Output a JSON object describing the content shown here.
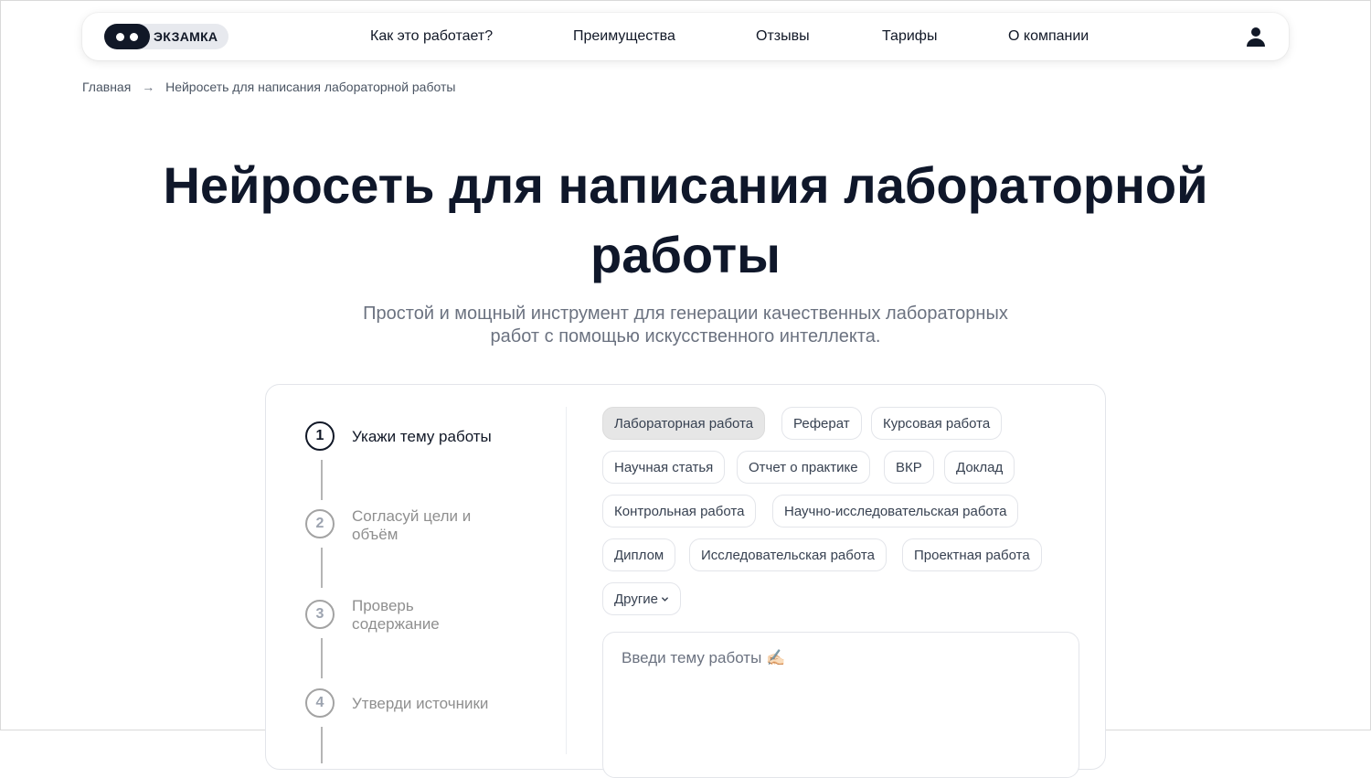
{
  "header": {
    "logo_text": "ЭКЗАМКА",
    "nav": [
      {
        "label": "Как это работает?"
      },
      {
        "label": "Преимущества"
      },
      {
        "label": "Отзывы"
      },
      {
        "label": "Тарифы"
      },
      {
        "label": "О компании"
      }
    ],
    "user_icon": "user-icon"
  },
  "breadcrumb": {
    "home": "Главная",
    "separator": "→",
    "current": "Нейросеть для написания лабораторной работы"
  },
  "hero": {
    "title_line1": "Нейросеть для написания лабораторной",
    "title_line2": "работы",
    "subtitle_line1": "Простой и мощный инструмент для генерации качественных лабораторных",
    "subtitle_line2": "работ с помощью искусственного интеллекта."
  },
  "steps": [
    {
      "number": "1",
      "label": "Укажи тему работы",
      "active": true
    },
    {
      "number": "2",
      "label": "Согласуй цели и объём",
      "active": false
    },
    {
      "number": "3",
      "label": "Проверь содержание",
      "active": false
    },
    {
      "number": "4",
      "label": "Утверди источники",
      "active": false
    }
  ],
  "work_types": {
    "selected": "Лабораторная работа",
    "items": [
      "Лабораторная работа",
      "Реферат",
      "Курсовая работа",
      "Научная статья",
      "Отчет о практике",
      "ВКР",
      "Доклад",
      "Контрольная работа",
      "Научно-исследовательская работа",
      "Диплом",
      "Исследовательская работа",
      "Проектная работа",
      "Другие"
    ]
  },
  "topic": {
    "placeholder": "Введи тему работы ✍🏻",
    "value": ""
  },
  "colors": {
    "text_dark": "#0f172a",
    "muted": "#6b7280",
    "chip_selected_bg": "#e6e6e6",
    "border": "#e3e5ea"
  }
}
